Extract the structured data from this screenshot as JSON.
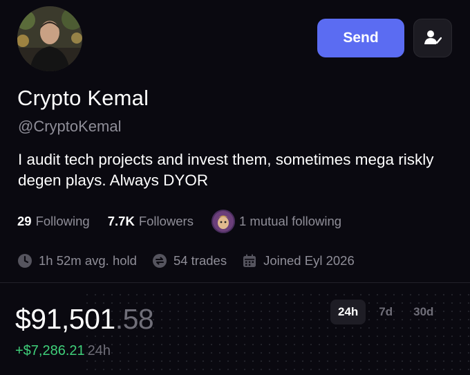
{
  "header": {
    "send_label": "Send"
  },
  "profile": {
    "display_name": "Crypto Kemal",
    "handle": "@CryptoKemal",
    "bio": "I audit tech projects and invest them, sometimes mega riskly degen plays. Always DYOR"
  },
  "stats": {
    "following_count": "29",
    "following_label": "Following",
    "followers_count": "7.7K",
    "followers_label": "Followers",
    "mutual_label": "1 mutual following"
  },
  "meta": {
    "avg_hold": "1h 52m avg. hold",
    "trades": "54 trades",
    "joined": "Joined Eyl 2026"
  },
  "portfolio": {
    "balance_main": "$91,501",
    "balance_cents": ".58",
    "change_amount": "+$7,286.21",
    "change_period": "24h",
    "tabs": [
      {
        "label": "24h",
        "active": true
      },
      {
        "label": "7d",
        "active": false
      },
      {
        "label": "30d",
        "active": false
      }
    ]
  },
  "colors": {
    "background": "#0a0910",
    "accent": "#5b6cf2",
    "positive": "#3fd07a",
    "muted": "#8f8e98"
  },
  "icons": [
    "user-check-icon",
    "clock-icon",
    "swap-icon",
    "calendar-icon"
  ]
}
